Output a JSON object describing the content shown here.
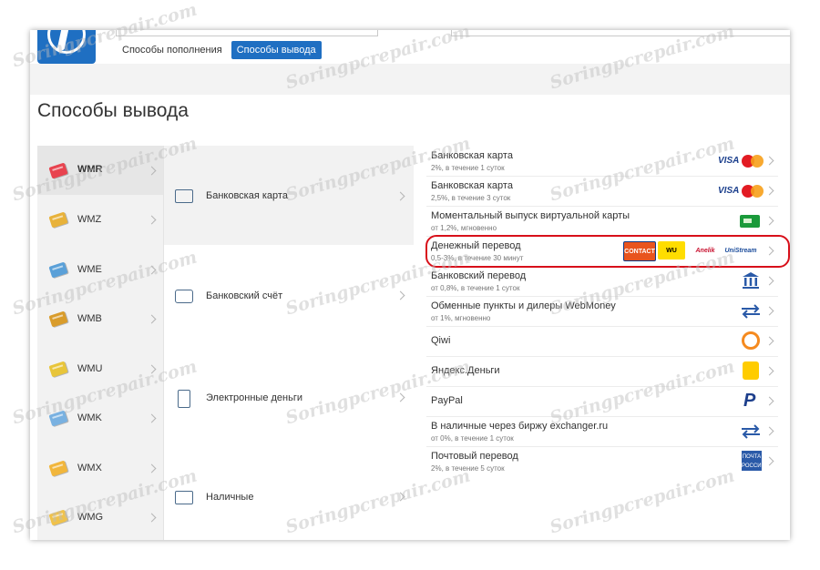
{
  "header": {
    "tabs": [
      {
        "label": "Способы пополнения",
        "active": false
      },
      {
        "label": "Способы вывода",
        "active": true
      }
    ]
  },
  "page_title": "Способы вывода",
  "currencies": [
    {
      "label": "WMR",
      "active": true,
      "color": "#e8434f"
    },
    {
      "label": "WMZ",
      "active": false,
      "color": "#e8b23a"
    },
    {
      "label": "WME",
      "active": false,
      "color": "#5aa0d8"
    },
    {
      "label": "WMB",
      "active": false,
      "color": "#d99c2b"
    },
    {
      "label": "WMU",
      "active": false,
      "color": "#e8c53a"
    },
    {
      "label": "WMK",
      "active": false,
      "color": "#79b1e1"
    },
    {
      "label": "WMX",
      "active": false,
      "color": "#f1b63c"
    },
    {
      "label": "WMG",
      "active": false,
      "color": "#f0c24a"
    }
  ],
  "categories": [
    {
      "label": "Банковская карта",
      "icon": "bank-card-icon",
      "active": true
    },
    {
      "label": "Банковский счёт",
      "icon": "safe-icon",
      "active": false
    },
    {
      "label": "Электронные деньги",
      "icon": "mobile-money-icon",
      "active": false
    },
    {
      "label": "Наличные",
      "icon": "cash-icon",
      "active": false
    }
  ],
  "methods": [
    {
      "title": "Банковская карта",
      "sub": "2%, в течение 1 суток",
      "logo": "visa-mastercard"
    },
    {
      "title": "Банковская карта",
      "sub": "2,5%, в течение 3 суток",
      "logo": "visa-mastercard"
    },
    {
      "title": "Моментальный выпуск виртуальной карты",
      "sub": "от 1,2%, мгновенно",
      "logo": "virtual-card",
      "highlighted": true
    },
    {
      "title": "Денежный перевод",
      "sub": "0,5-3%, в течение 30 минут",
      "logo": "money-transfer"
    },
    {
      "title": "Банковский перевод",
      "sub": "от 0,8%, в течение 1 суток",
      "logo": "bank"
    },
    {
      "title": "Обменные пункты и дилеры WebMoney",
      "sub": "от 1%, мгновенно",
      "logo": "exchange-arrows"
    },
    {
      "title": "Qiwi",
      "sub": "",
      "logo": "qiwi"
    },
    {
      "title": "Яндекс.Деньги",
      "sub": "",
      "logo": "yandex-money"
    },
    {
      "title": "PayPal",
      "sub": "",
      "logo": "paypal"
    },
    {
      "title": "В наличные через биржу exchanger.ru",
      "sub": "от 0%, в течение 1 суток",
      "logo": "exchange-arrows"
    },
    {
      "title": "Почтовый перевод",
      "sub": "2%, в течение 5 суток",
      "logo": "russian-post"
    }
  ],
  "logos": {
    "visa": "VISA",
    "contact": "CONTACT",
    "wu": "WU",
    "anelik": "Anelik",
    "unistream": "UniStream",
    "paypal": "P",
    "post": "ПОЧТА РОССИИ"
  },
  "watermark": "Soringpcrepair.com",
  "colors": {
    "accent": "#1f6fc2",
    "highlight": "#d8101a"
  }
}
